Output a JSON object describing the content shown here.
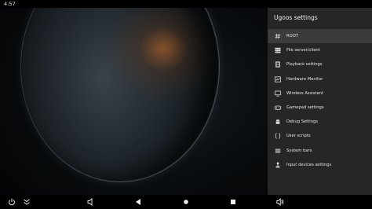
{
  "status_bar": {
    "time": "4:57"
  },
  "panel": {
    "title": "Ugoos settings",
    "items": [
      {
        "label": "ROOT",
        "icon": "hash-icon",
        "selected": true
      },
      {
        "label": "File server/client",
        "icon": "server-icon",
        "selected": false
      },
      {
        "label": "Playback settings",
        "icon": "film-icon",
        "selected": false
      },
      {
        "label": "Hardware Monitor",
        "icon": "monitor-graph-icon",
        "selected": false
      },
      {
        "label": "Wireless Assistant",
        "icon": "cast-icon",
        "selected": false
      },
      {
        "label": "Gamepad settings",
        "icon": "gamepad-icon",
        "selected": false
      },
      {
        "label": "Debug Settings",
        "icon": "android-icon",
        "selected": false
      },
      {
        "label": "User scripts",
        "icon": "braces-icon",
        "selected": false
      },
      {
        "label": "System bars",
        "icon": "bars-icon",
        "selected": false
      },
      {
        "label": "Input devices settings",
        "icon": "joystick-icon",
        "selected": false
      }
    ]
  },
  "nav_bar": {
    "buttons": [
      "power-icon",
      "collapse-icon",
      "volume-down-icon",
      "back-icon",
      "home-icon",
      "recents-icon",
      "volume-up-icon"
    ]
  },
  "colors": {
    "panel_bg": "#262626",
    "selected_bg": "#3b3b3b",
    "text": "#e6e6e6"
  }
}
